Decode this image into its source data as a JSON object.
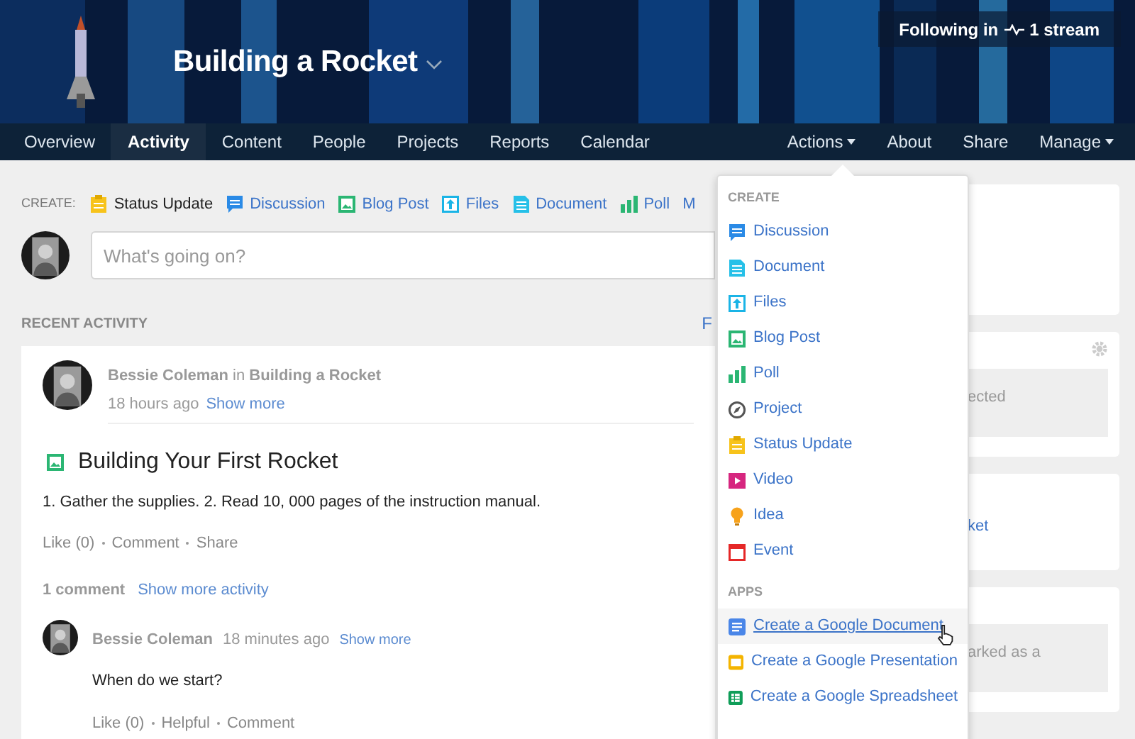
{
  "header": {
    "title": "Building a Rocket",
    "following": {
      "label": "Following in",
      "count": "1 stream"
    }
  },
  "nav": {
    "left": [
      {
        "label": "Overview",
        "selected": false
      },
      {
        "label": "Activity",
        "selected": true
      },
      {
        "label": "Content",
        "selected": false
      },
      {
        "label": "People",
        "selected": false
      },
      {
        "label": "Projects",
        "selected": false
      },
      {
        "label": "Reports",
        "selected": false
      },
      {
        "label": "Calendar",
        "selected": false
      }
    ],
    "right": [
      {
        "label": "Actions",
        "dropdown": true
      },
      {
        "label": "About",
        "dropdown": false
      },
      {
        "label": "Share",
        "dropdown": false
      },
      {
        "label": "Manage",
        "dropdown": true
      }
    ]
  },
  "create_bar": {
    "label": "CREATE:",
    "items": [
      {
        "kind": "status",
        "label": "Status Update",
        "selected": true
      },
      {
        "kind": "discussion",
        "label": "Discussion",
        "selected": false
      },
      {
        "kind": "blog",
        "label": "Blog Post",
        "selected": false
      },
      {
        "kind": "files",
        "label": "Files",
        "selected": false
      },
      {
        "kind": "document",
        "label": "Document",
        "selected": false
      },
      {
        "kind": "poll",
        "label": "Poll",
        "selected": false
      },
      {
        "kind": "none",
        "label": "M",
        "selected": false
      }
    ]
  },
  "composer": {
    "placeholder": "What's going on?"
  },
  "recent_activity": {
    "label": "RECENT ACTIVITY",
    "filter_link": "F"
  },
  "post": {
    "author": "Bessie Coleman",
    "in_word": "in",
    "place": "Building a Rocket",
    "time": "18 hours ago",
    "show_more": "Show more",
    "title": "Building Your First Rocket",
    "body": "1. Gather the supplies. 2. Read 10, 000 pages of the instruction manual.",
    "actions": [
      "Like (0)",
      "Comment",
      "Share"
    ],
    "comment_count": "1 comment",
    "show_more_activity": "Show more activity",
    "comments": [
      {
        "author": "Bessie Coleman",
        "time": "18 minutes ago",
        "show_more": "Show more",
        "text": "When do we start?",
        "actions": [
          "Like (0)",
          "Helpful",
          "Comment"
        ]
      }
    ]
  },
  "actions_menu": {
    "sections": [
      {
        "heading": "CREATE",
        "items": [
          {
            "kind": "discussion",
            "label": "Discussion",
            "hovered": false
          },
          {
            "kind": "document",
            "label": "Document",
            "hovered": false
          },
          {
            "kind": "files",
            "label": "Files",
            "hovered": false
          },
          {
            "kind": "blog",
            "label": "Blog Post",
            "hovered": false
          },
          {
            "kind": "poll",
            "label": "Poll",
            "hovered": false
          },
          {
            "kind": "project",
            "label": "Project",
            "hovered": false
          },
          {
            "kind": "status",
            "label": "Status Update",
            "hovered": false
          },
          {
            "kind": "video",
            "label": "Video",
            "hovered": false
          },
          {
            "kind": "idea",
            "label": "Idea",
            "hovered": false
          },
          {
            "kind": "event",
            "label": "Event",
            "hovered": false
          }
        ]
      },
      {
        "heading": "APPS",
        "items": [
          {
            "kind": "gdoc",
            "label": "Create a Google Document",
            "hovered": true
          },
          {
            "kind": "gslides",
            "label": "Create a Google Presentation",
            "hovered": false
          },
          {
            "kind": "gsheets",
            "label": "Create a Google Spreadsheet",
            "hovered": false
          }
        ]
      }
    ]
  },
  "side_cards": [
    {
      "kind": "empty"
    },
    {
      "kind": "gray",
      "text": "ected",
      "gear": true
    },
    {
      "kind": "link",
      "text": "ket"
    },
    {
      "kind": "gray",
      "text": "arked as a",
      "gear": false
    }
  ]
}
